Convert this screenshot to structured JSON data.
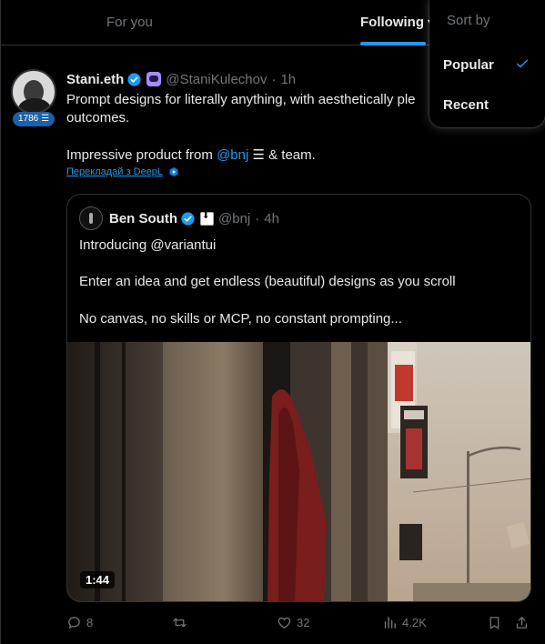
{
  "tabs": {
    "for_you": "For you",
    "following": "Following"
  },
  "sort_menu": {
    "title": "Sort by",
    "options": [
      "Popular",
      "Recent"
    ],
    "selected": "Popular"
  },
  "post": {
    "author_name": "Stani.eth",
    "handle": "@StaniKulechov",
    "time": "1h",
    "badge_count": "1786",
    "text_line1": "Prompt designs for literally anything, with aesthetically ple",
    "text_line1b": "outcomes.",
    "text_line2_prefix": "Impressive product from ",
    "text_line2_mention": "@bnj",
    "text_line2_suffix": " & team.",
    "translate_label": "Перекладай з DeepL",
    "quote": {
      "author_name": "Ben South",
      "handle": "@bnj",
      "time": "4h",
      "line1": "Introducing @variantui",
      "line2": "Enter an idea and get endless (beautiful) designs as you scroll",
      "line3": "No canvas, no skills or MCP, no constant prompting...",
      "video_duration": "1:44"
    },
    "actions": {
      "replies": "8",
      "likes": "32",
      "views": "4.2K"
    }
  },
  "colors": {
    "accent": "#1d9bf0",
    "muted": "#71767b",
    "background": "#000000",
    "border": "#2f3336"
  },
  "icons": [
    "verified-icon",
    "affiliate-icon",
    "check-icon",
    "deepl-icon",
    "reply-icon",
    "retweet-icon",
    "like-icon",
    "views-icon",
    "bookmark-icon",
    "share-icon"
  ]
}
